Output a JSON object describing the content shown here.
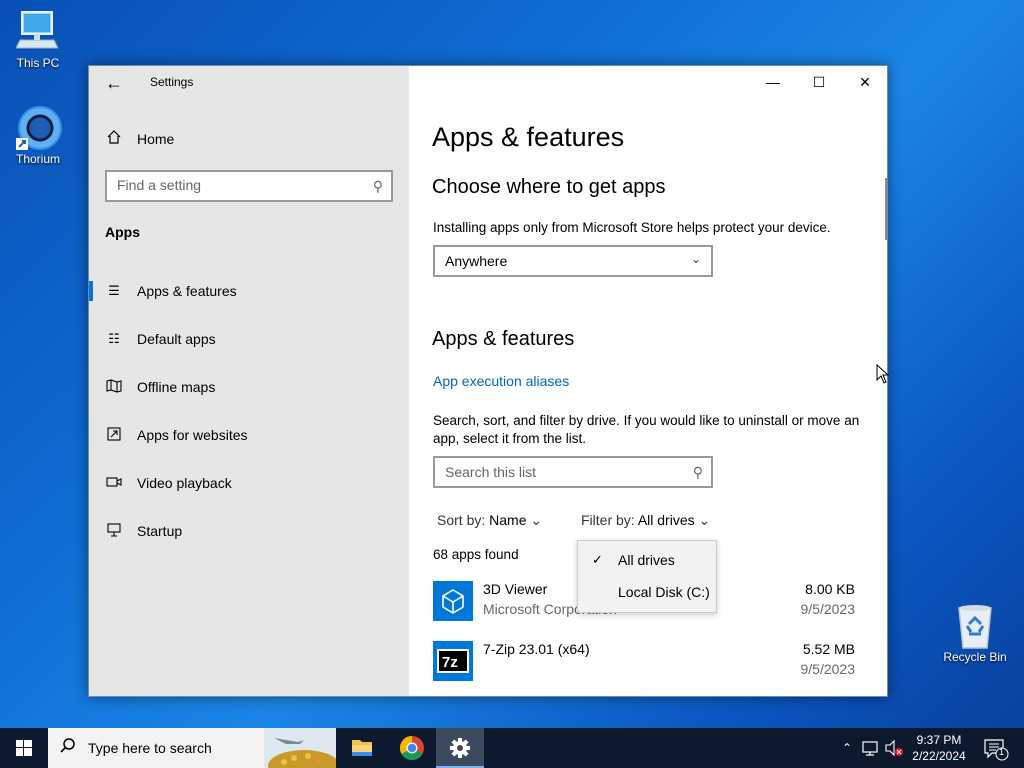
{
  "desktop": {
    "icons": [
      {
        "label": "This PC"
      },
      {
        "label": "Thorium"
      },
      {
        "label": "Recycle Bin"
      }
    ]
  },
  "window": {
    "title": "Settings",
    "controls": {
      "minimize": "minimize-icon",
      "maximize": "maximize-icon",
      "close": "close-icon"
    }
  },
  "sidebar": {
    "home_label": "Home",
    "search_placeholder": "Find a setting",
    "section_label": "Apps",
    "items": [
      {
        "label": "Apps & features",
        "icon": "list-icon",
        "active": true
      },
      {
        "label": "Default apps",
        "icon": "default-apps-icon",
        "active": false
      },
      {
        "label": "Offline maps",
        "icon": "map-icon",
        "active": false
      },
      {
        "label": "Apps for websites",
        "icon": "link-window-icon",
        "active": false
      },
      {
        "label": "Video playback",
        "icon": "video-icon",
        "active": false
      },
      {
        "label": "Startup",
        "icon": "startup-icon",
        "active": false
      }
    ]
  },
  "main": {
    "page_title": "Apps & features",
    "where_heading": "Choose where to get apps",
    "where_desc": "Installing apps only from Microsoft Store helps protect your device.",
    "where_value": "Anywhere",
    "apps_heading": "Apps & features",
    "aliases_link": "App execution aliases",
    "search_desc": "Search, sort, and filter by drive. If you would like to uninstall or move an app, select it from the list.",
    "search_placeholder": "Search this list",
    "sort_label": "Sort by:",
    "sort_value": "Name",
    "filter_label": "Filter by:",
    "filter_value": "All drives",
    "apps_count": "68 apps found",
    "apps": [
      {
        "name": "3D Viewer",
        "publisher": "Microsoft Corporation",
        "size": "8.00 KB",
        "date": "9/5/2023"
      },
      {
        "name": "7-Zip 23.01 (x64)",
        "publisher": "",
        "size": "5.52 MB",
        "date": "9/5/2023"
      }
    ]
  },
  "filter_dropdown": {
    "options": [
      {
        "label": "All drives",
        "selected": true
      },
      {
        "label": "Local Disk (C:)",
        "selected": false
      }
    ]
  },
  "taskbar": {
    "search_placeholder": "Type here to search",
    "time": "9:37 PM",
    "date": "2/22/2024",
    "notification_count": "1"
  },
  "colors": {
    "accent": "#0078d7",
    "link": "#0067b8",
    "sidebar_bg": "#e6e6e6"
  }
}
